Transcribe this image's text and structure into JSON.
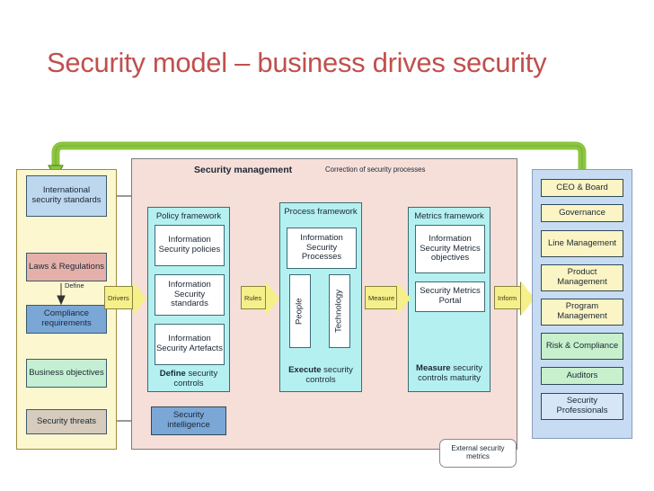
{
  "slide": {
    "title": "Security model – business drives security",
    "title_color": "#c0504d"
  },
  "center_panel": {
    "heading": "Security management",
    "correction_label": "Correction of security processes"
  },
  "left_panel": {
    "define_label": "Define",
    "items": [
      {
        "label": "International security standards",
        "color": "#bdd7ee"
      },
      {
        "label": "Laws & Regulations",
        "color": "#e6b0aa"
      },
      {
        "label": "Compliance requirements",
        "color": "#7ba7d7"
      },
      {
        "label": "Business objectives",
        "color": "#c5efd2"
      },
      {
        "label": "Security threats",
        "color": "#d6cbbd"
      }
    ]
  },
  "frameworks": [
    {
      "title": "Policy framework",
      "footer_bold": "Define",
      "footer_rest": " security controls",
      "items": [
        "Information Security policies",
        "Information Security standards",
        "Information Security Artefacts"
      ]
    },
    {
      "title": "Process framework",
      "footer_bold": "Execute",
      "footer_rest": " security controls",
      "items": [
        "Information Security Processes"
      ],
      "pillars": [
        "People",
        "Technology"
      ]
    },
    {
      "title": "Metrics framework",
      "footer_bold": "Measure",
      "footer_rest": " security controls maturity",
      "items": [
        "Information Security Metrics objectives",
        "Security Metrics Portal"
      ]
    }
  ],
  "flow_arrows": [
    {
      "label": "Drivers"
    },
    {
      "label": "Rules"
    },
    {
      "label": "Measure"
    },
    {
      "label": "Inform"
    }
  ],
  "security_intelligence": {
    "label": "Security intelligence",
    "color": "#7ba7d7"
  },
  "external_metrics": {
    "label": "External security metrics"
  },
  "right_panel": {
    "items": [
      {
        "label": "CEO & Board",
        "color": "#fbf4c4"
      },
      {
        "label": "Governance",
        "color": "#fbf4c4"
      },
      {
        "label": "Line Management",
        "color": "#fbf4c4"
      },
      {
        "label": "Product Management",
        "color": "#fbf4c4"
      },
      {
        "label": "Program Management",
        "color": "#fbf4c4"
      },
      {
        "label": "Risk & Compliance",
        "color": "#c8f0cd"
      },
      {
        "label": "Auditors",
        "color": "#c8f0cd"
      },
      {
        "label": "Security Professionals",
        "color": "#d6e6f7"
      }
    ]
  },
  "colors": {
    "green_connector": "#8cc63f",
    "orange_connector": "#f5a623",
    "gray_arrow": "#6e8076",
    "panel_left_bg": "#fcf7cf",
    "panel_center_bg": "#f6ded9",
    "panel_right_bg": "#c7dcf2",
    "framework_bg": "#b5f0f0"
  }
}
